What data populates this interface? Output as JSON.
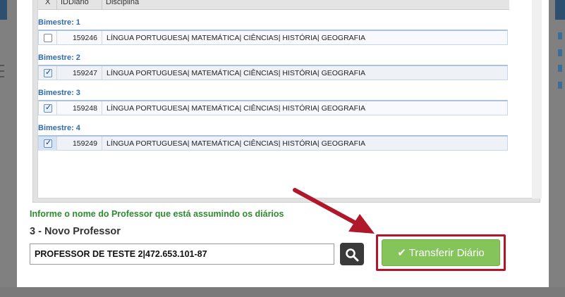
{
  "grid": {
    "headers": {
      "x": "X",
      "id": "IDDiario",
      "discipline": "Disciplina"
    },
    "groups": [
      {
        "label": "Bimestre: 1",
        "id": "159246",
        "discipline": "LÍNGUA PORTUGUESA| MATEMÁTICA| CIÊNCIAS| HISTÓRIA| GEOGRAFIA",
        "checked": false
      },
      {
        "label": "Bimestre: 2",
        "id": "159247",
        "discipline": "LÍNGUA PORTUGUESA| MATEMÁTICA| CIÊNCIAS| HISTÓRIA| GEOGRAFIA",
        "checked": true
      },
      {
        "label": "Bimestre: 3",
        "id": "159248",
        "discipline": "LÍNGUA PORTUGUESA| MATEMÁTICA| CIÊNCIAS| HISTÓRIA| GEOGRAFIA",
        "checked": true
      },
      {
        "label": "Bimestre: 4",
        "id": "159249",
        "discipline": "LÍNGUA PORTUGUESA| MATEMÁTICA| CIÊNCIAS| HISTÓRIA| GEOGRAFIA",
        "checked": true
      }
    ]
  },
  "form": {
    "info": "Informe o nome do Professor que está assumindo os diários",
    "section_title": "3 - Novo Professor",
    "professor_value": "PROFESSOR DE TESTE 2|472.653.101-87",
    "search_icon": "search-icon",
    "transfer_label": "Transferir Diário",
    "transfer_icon": "check-icon"
  },
  "colors": {
    "accent_green": "#84c45a",
    "group_label": "#2f6bab",
    "info_text": "#2e8b2e",
    "highlight_box": "#b1172a"
  }
}
